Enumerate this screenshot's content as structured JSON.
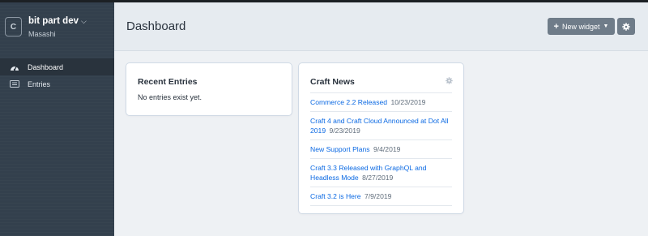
{
  "site": {
    "badge": "C",
    "name": "bit part dev",
    "chevron": "⌵",
    "user": "Masashi"
  },
  "nav": [
    {
      "label": "Dashboard",
      "icon": "dashboard-icon",
      "active": true
    },
    {
      "label": "Entries",
      "icon": "entries-icon",
      "active": false
    }
  ],
  "header": {
    "title": "Dashboard",
    "new_widget_label": "New widget",
    "settings_icon": "gear-icon"
  },
  "widgets": {
    "recent": {
      "title": "Recent Entries",
      "empty_text": "No entries exist yet."
    },
    "news": {
      "title": "Craft News",
      "items": [
        {
          "title": "Commerce 2.2 Released",
          "date": "10/23/2019"
        },
        {
          "title": "Craft 4 and Craft Cloud Announced at Dot All 2019",
          "date": "9/23/2019"
        },
        {
          "title": "New Support Plans",
          "date": "9/4/2019"
        },
        {
          "title": "Craft 3.3 Released with GraphQL and Headless Mode",
          "date": "8/27/2019"
        },
        {
          "title": "Craft 3.2 is Here",
          "date": "7/9/2019"
        }
      ]
    }
  },
  "colors": {
    "sidebar": "#33404d",
    "link": "#0b69e3",
    "button": "#6f7c89",
    "background": "#e6ebf0"
  }
}
